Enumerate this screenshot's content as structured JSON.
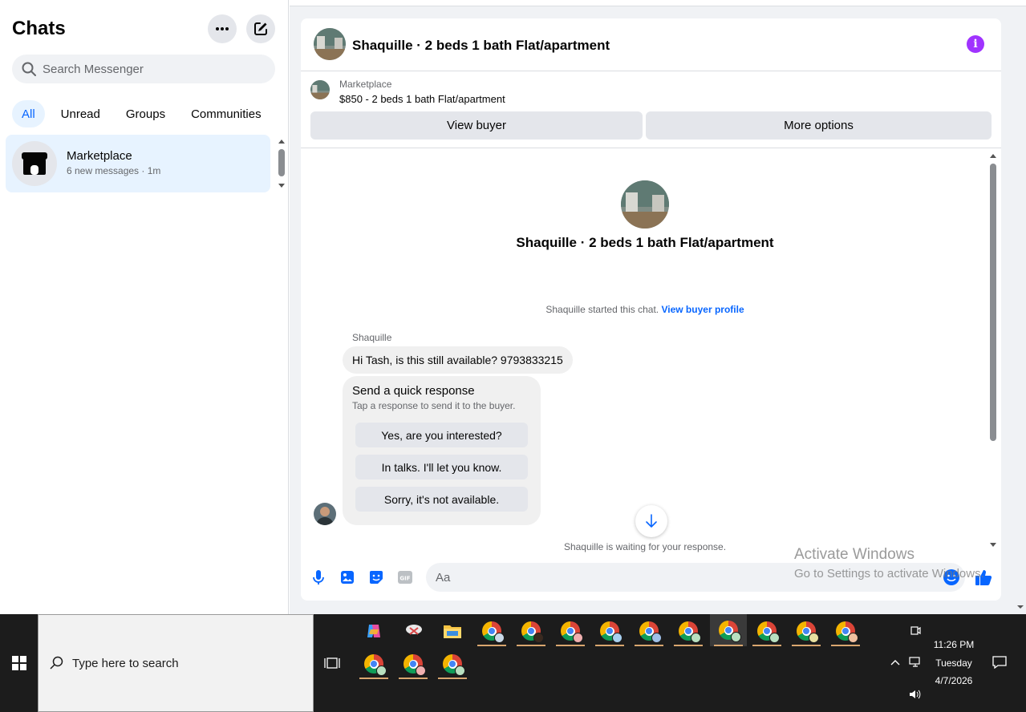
{
  "sidebar": {
    "title": "Chats",
    "search_placeholder": "Search Messenger",
    "filters": [
      "All",
      "Unread",
      "Groups",
      "Communities"
    ],
    "active_filter": "All",
    "chats": [
      {
        "name": "Marketplace",
        "subtitle": "6 new messages · 1m"
      }
    ]
  },
  "conversation": {
    "title": "Shaquille · 2 beds 1 bath Flat/apartment",
    "listing": {
      "label": "Marketplace",
      "price_line": "$850 - 2 beds 1 bath Flat/apartment"
    },
    "buttons": {
      "view_buyer": "View buyer",
      "more_options": "More options"
    },
    "intro_title": "Shaquille · 2 beds 1 bath Flat/apartment",
    "started_text": "Shaquille started this chat.",
    "started_link": "View buyer profile",
    "messages": [
      {
        "sender": "Shaquille",
        "text": "Hi Tash, is this still available? 9793833215"
      }
    ],
    "quick_response": {
      "title": "Send a quick response",
      "subtitle": "Tap a response to send it to the buyer.",
      "options": [
        "Yes, are you interested?",
        "In talks. I'll let you know.",
        "Sorry, it's not available."
      ]
    },
    "waiting_text": "Shaquille is waiting for your response.",
    "composer_placeholder": "Aa",
    "accent_color": "#0866ff",
    "info_color": "#a033ff"
  },
  "watermark": {
    "line1": "Activate Windows",
    "line2": "Go to Settings to activate Windows."
  },
  "taskbar": {
    "search_placeholder": "Type here to search",
    "time": "11:26 PM",
    "day": "Tuesday",
    "date": "4/7/2026"
  }
}
